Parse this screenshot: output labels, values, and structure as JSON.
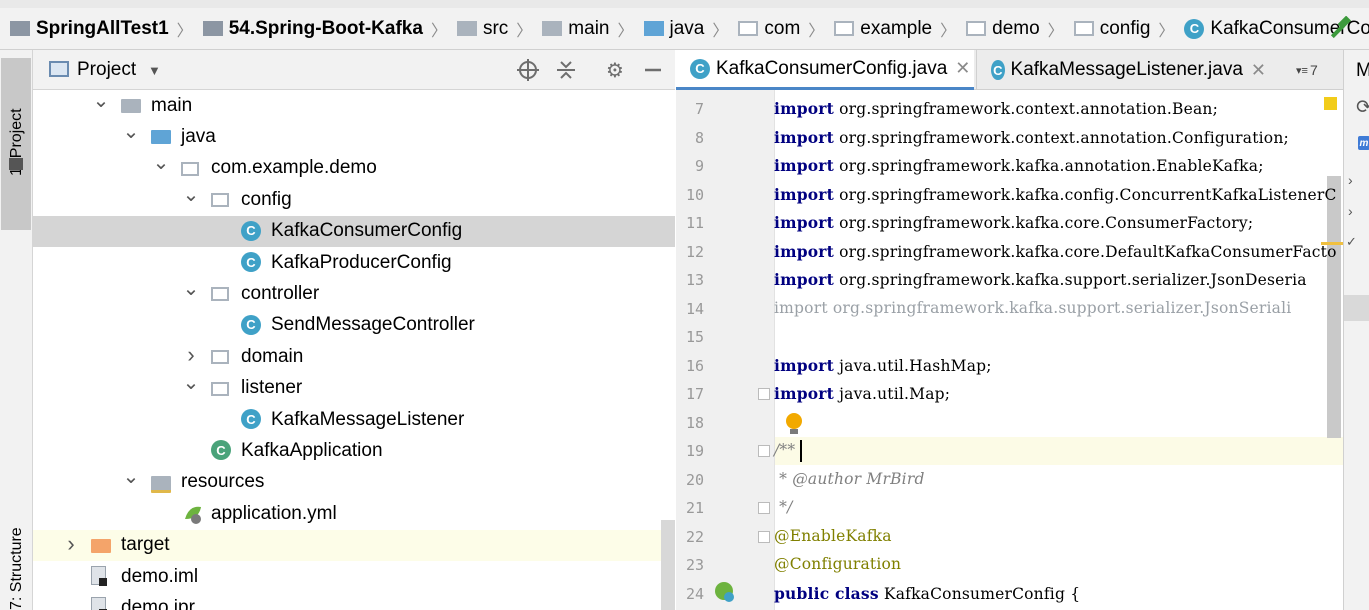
{
  "breadcrumb": [
    {
      "label": "SpringAllTest1",
      "icon": "module-folder-icon",
      "bold": true
    },
    {
      "label": "54.Spring-Boot-Kafka",
      "icon": "module-folder-icon",
      "bold": true
    },
    {
      "label": "src",
      "icon": "folder-icon",
      "bold": false
    },
    {
      "label": "main",
      "icon": "folder-icon",
      "bold": false
    },
    {
      "label": "java",
      "icon": "source-folder-icon",
      "bold": false
    },
    {
      "label": "com",
      "icon": "package-icon",
      "bold": false
    },
    {
      "label": "example",
      "icon": "package-icon",
      "bold": false
    },
    {
      "label": "demo",
      "icon": "package-icon",
      "bold": false
    },
    {
      "label": "config",
      "icon": "package-icon",
      "bold": false
    },
    {
      "label": "KafkaConsumerConfig",
      "icon": "class-icon",
      "bold": false
    }
  ],
  "left_strip": {
    "project_tab": "1: Project",
    "structure_tab": "7: Structure"
  },
  "project_panel": {
    "title": "Project"
  },
  "tree": [
    {
      "label": "main",
      "icon": "folder",
      "expand": "open"
    },
    {
      "label": "java",
      "icon": "source-folder",
      "expand": "open"
    },
    {
      "label": "com.example.demo",
      "icon": "package",
      "expand": "open"
    },
    {
      "label": "config",
      "icon": "package",
      "expand": "open"
    },
    {
      "label": "KafkaConsumerConfig",
      "icon": "class",
      "expand": "none",
      "selected": true
    },
    {
      "label": "KafkaProducerConfig",
      "icon": "class",
      "expand": "none"
    },
    {
      "label": "controller",
      "icon": "package",
      "expand": "open"
    },
    {
      "label": "SendMessageController",
      "icon": "class",
      "expand": "none"
    },
    {
      "label": "domain",
      "icon": "package",
      "expand": "closed"
    },
    {
      "label": "listener",
      "icon": "package",
      "expand": "open"
    },
    {
      "label": "KafkaMessageListener",
      "icon": "class",
      "expand": "none"
    },
    {
      "label": "KafkaApplication",
      "icon": "spring-class",
      "expand": "none"
    },
    {
      "label": "resources",
      "icon": "resources-folder",
      "expand": "open"
    },
    {
      "label": "application.yml",
      "icon": "spring-yml",
      "expand": "none"
    },
    {
      "label": "target",
      "icon": "excluded-folder",
      "expand": "closed",
      "highlight": true
    },
    {
      "label": "demo.iml",
      "icon": "iml-file",
      "expand": "none"
    },
    {
      "label": "demo.ipr",
      "icon": "iml-file",
      "expand": "none"
    }
  ],
  "tabs": [
    {
      "label": "KafkaConsumerConfig.java",
      "active": true
    },
    {
      "label": "KafkaMessageListener.java",
      "active": false
    }
  ],
  "tab_overflow": "7",
  "right_strip_label": "M",
  "code_lines": [
    {
      "n": "7",
      "text": "import org.springframework.context.annotation.Bean;"
    },
    {
      "n": "8",
      "text": "import org.springframework.context.annotation.Configuration;"
    },
    {
      "n": "9",
      "text": "import org.springframework.kafka.annotation.EnableKafka;"
    },
    {
      "n": "10",
      "text": "import org.springframework.kafka.config.ConcurrentKafkaListenerC"
    },
    {
      "n": "11",
      "text": "import org.springframework.kafka.core.ConsumerFactory;"
    },
    {
      "n": "12",
      "text": "import org.springframework.kafka.core.DefaultKafkaConsumerFacto"
    },
    {
      "n": "13",
      "text": "import org.springframework.kafka.support.serializer.JsonDeseria"
    },
    {
      "n": "14",
      "text": "import org.springframework.kafka.support.serializer.JsonSeriali"
    },
    {
      "n": "15",
      "text": ""
    },
    {
      "n": "16",
      "text": "import java.util.HashMap;"
    },
    {
      "n": "17",
      "text": "import java.util.Map;"
    },
    {
      "n": "18",
      "text": ""
    },
    {
      "n": "19",
      "text": "/**"
    },
    {
      "n": "20",
      "text": " * @author MrBird"
    },
    {
      "n": "21",
      "text": " */"
    },
    {
      "n": "22",
      "text": "@EnableKafka"
    },
    {
      "n": "23",
      "text": "@Configuration"
    },
    {
      "n": "24",
      "text": "public class KafkaConsumerConfig {"
    }
  ],
  "colors": {
    "selection": "#d5d5d5",
    "current_line": "#fcfbe6",
    "keyword": "#000080",
    "annotation": "#808000",
    "accent_tab": "#4a86c7"
  }
}
